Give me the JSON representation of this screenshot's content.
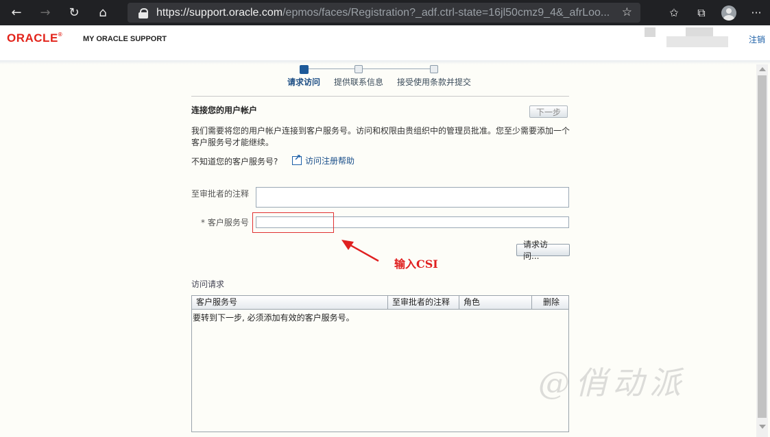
{
  "browser": {
    "url_host": "https://support.oracle.com",
    "url_path": "/epmos/faces/Registration?_adf.ctrl-state=16jl50cmz9_4&_afrLoo...",
    "icons": [
      "back-arrow-icon",
      "forward-arrow-icon",
      "refresh-icon",
      "home-icon",
      "lock-icon",
      "star-icon",
      "favorites-icon",
      "collections-icon",
      "profile-icon",
      "more-icon"
    ]
  },
  "header": {
    "logo": "ORACLE",
    "product": "MY ORACLE SUPPORT",
    "logout": "注销"
  },
  "train": {
    "steps": [
      {
        "label": "请求访问",
        "active": true
      },
      {
        "label": "提供联系信息",
        "active": false
      },
      {
        "label": "接受使用条款并提交",
        "active": false
      }
    ]
  },
  "main": {
    "title": "连接您的用户帐户",
    "next_button": "下一步",
    "description": "我们需要将您的用户帐户连接到客户服务号。访问和权限由贵组织中的管理员批准。您至少需要添加一个客户服务号才能继续。",
    "question": "不知道您的客户服务号?",
    "help_link": "访问注册帮助",
    "note_label": "至审批者的注释",
    "note_value": "",
    "csi_required_mark": "*",
    "csi_label": "客户服务号",
    "csi_value": "",
    "request_button": "请求访问...",
    "annotation": "输入CSI"
  },
  "requests": {
    "title": "访问请求",
    "columns": [
      "客户服务号",
      "至审批者的注释",
      "角色",
      "删除"
    ],
    "empty_message": "要转到下一步, 必须添加有效的客户服务号。"
  },
  "watermark": "@俏动派",
  "colors": {
    "oracle_red": "#e2231a",
    "link_blue": "#1a5ea6",
    "annotation_red": "#e02020"
  }
}
